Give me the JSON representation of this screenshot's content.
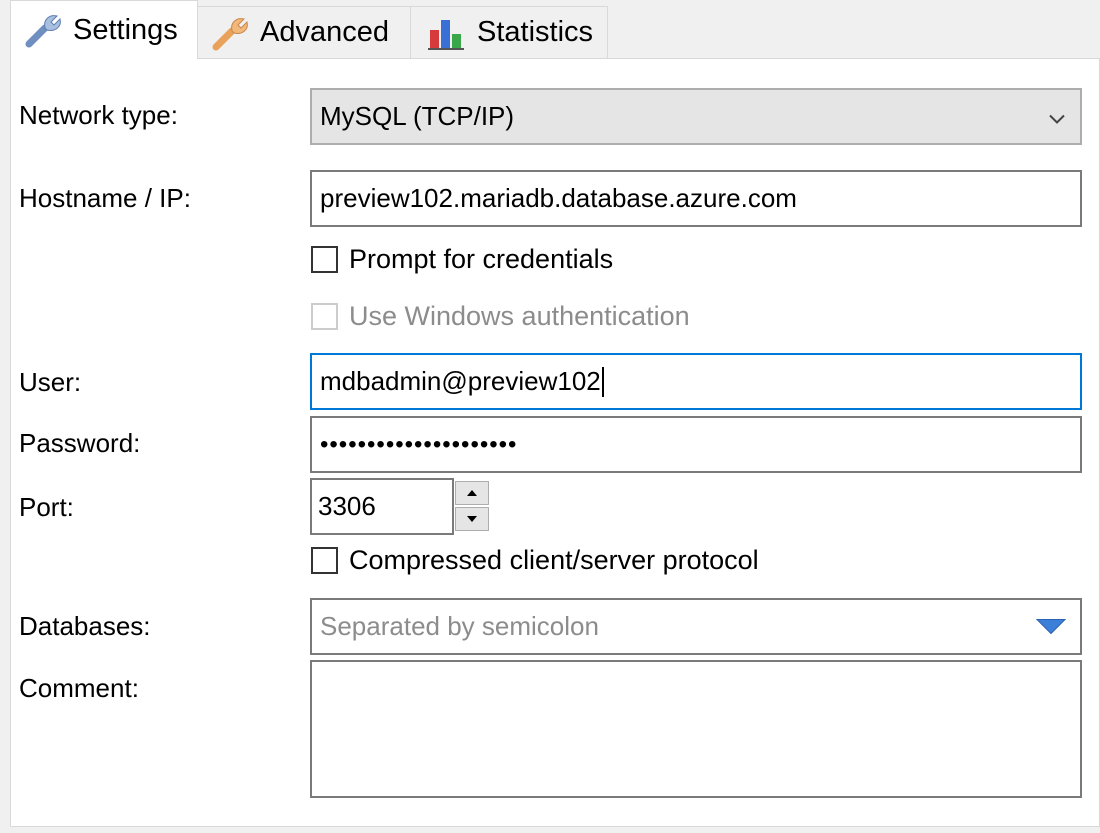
{
  "tabs": [
    {
      "label": "Settings",
      "icon": "wrench-icon",
      "active": true
    },
    {
      "label": "Advanced",
      "icon": "wrench-orange-icon",
      "active": false
    },
    {
      "label": "Statistics",
      "icon": "bar-chart-icon",
      "active": false
    }
  ],
  "form": {
    "network_type": {
      "label": "Network type:",
      "value": "MySQL (TCP/IP)"
    },
    "hostname": {
      "label": "Hostname / IP:",
      "value": "preview102.mariadb.database.azure.com"
    },
    "prompt_credentials": {
      "label": "Prompt for credentials",
      "checked": false
    },
    "windows_auth": {
      "label": "Use Windows authentication",
      "checked": false,
      "disabled": true
    },
    "user": {
      "label": "User:",
      "value": "mdbadmin@preview102"
    },
    "password": {
      "label": "Password:",
      "value": "•••••••••••••••••••••"
    },
    "port": {
      "label": "Port:",
      "value": "3306"
    },
    "compressed": {
      "label": "Compressed client/server protocol",
      "checked": false
    },
    "databases": {
      "label": "Databases:",
      "placeholder": "Separated by semicolon"
    },
    "comment": {
      "label": "Comment:",
      "value": ""
    }
  },
  "colors": {
    "focus_border": "#0078d7",
    "dropdown_arrow": "#3c7fd8"
  }
}
